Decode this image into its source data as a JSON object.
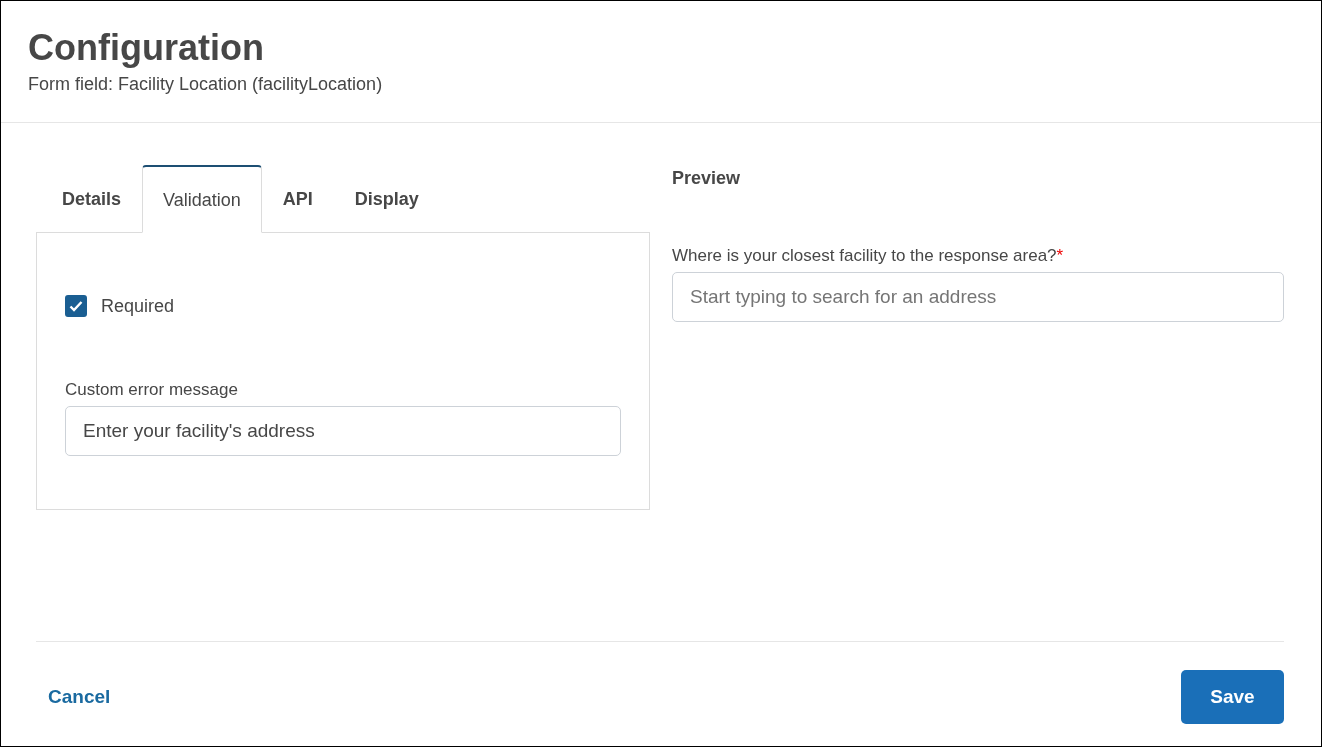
{
  "header": {
    "title": "Configuration",
    "subtitle": "Form field: Facility Location (facilityLocation)"
  },
  "tabs": [
    {
      "label": "Details",
      "selected": false
    },
    {
      "label": "Validation",
      "selected": true
    },
    {
      "label": "API",
      "selected": false
    },
    {
      "label": "Display",
      "selected": false
    }
  ],
  "validation": {
    "required": {
      "label": "Required",
      "checked": true
    },
    "error_message": {
      "label": "Custom error message",
      "value": "Enter your facility's address"
    }
  },
  "preview": {
    "title": "Preview",
    "label": "Where is your closest facility to the response area?",
    "required_mark": "*",
    "placeholder": "Start typing to search for an address"
  },
  "footer": {
    "cancel": "Cancel",
    "save": "Save"
  }
}
